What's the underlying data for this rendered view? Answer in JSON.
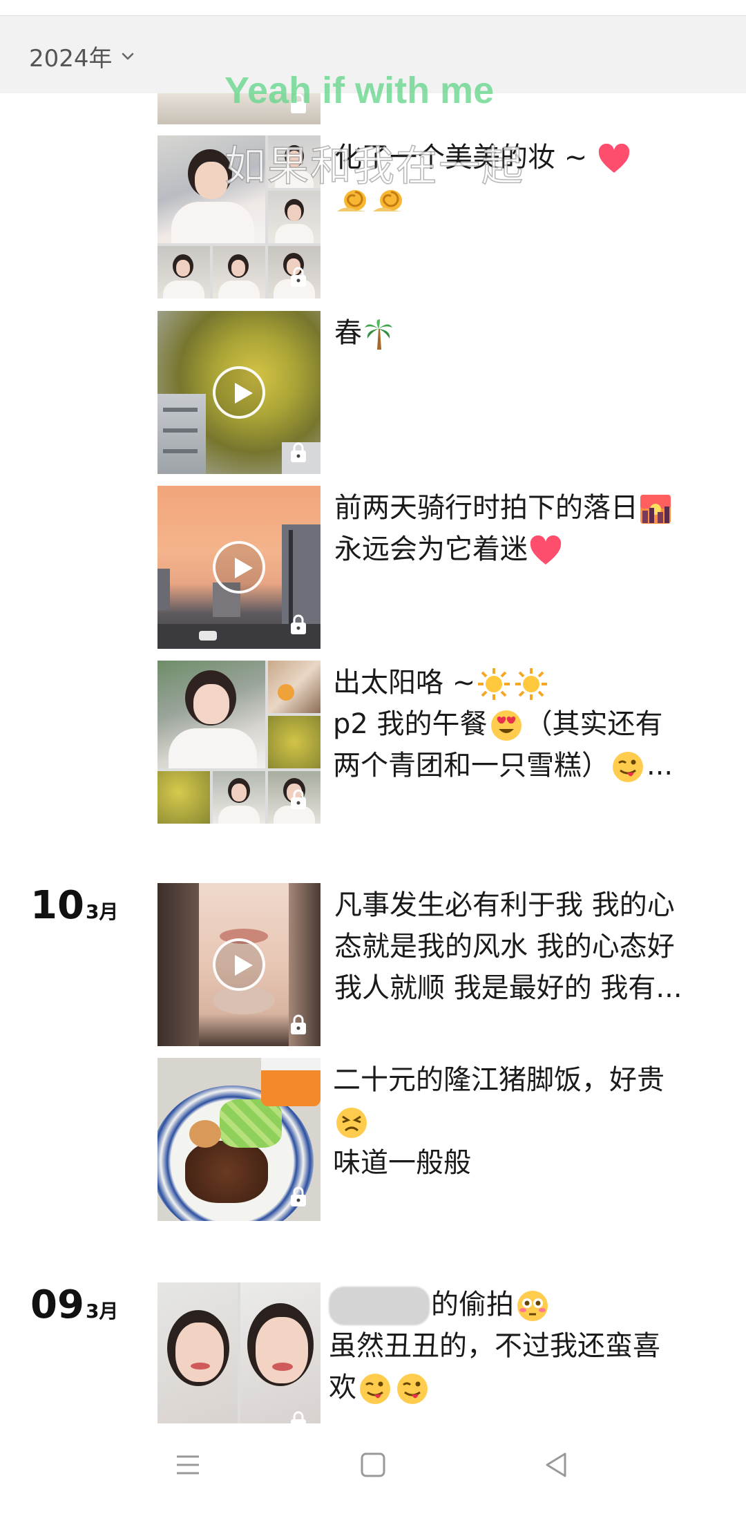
{
  "header": {
    "year_label": "2024年"
  },
  "overlay": {
    "english_lyric": "Yeah if with me",
    "chinese_lyric": "如果和我在一起"
  },
  "posts": [
    {
      "text": "化了一个美美的妆 ~",
      "emoji": [
        "heart",
        "snail",
        "snail"
      ]
    },
    {
      "text": "春",
      "emoji": [
        "palm-tree"
      ]
    },
    {
      "line1": "前两天骑行时拍下的落日",
      "line2": "永远会为它着迷",
      "emoji": [
        "sunset",
        "heart"
      ]
    },
    {
      "line1": "出太阳咯 ~",
      "line2": "p2 我的午餐",
      "line3a": "（其实还有",
      "line3b": "两个青团和一只雪糕）",
      "ellipsis": "...",
      "emoji": [
        "sun",
        "sun",
        "heart-eyes",
        "wink-tongue"
      ]
    },
    {
      "line1": "凡事发生必有利于我 我的心",
      "line2": "态就是我的风水 我的心态好",
      "line3": "我人就顺 我是最好的 我有...",
      "emoji": []
    },
    {
      "line1": "二十元的隆江猪脚饭，好贵",
      "line2": "味道一般般",
      "emoji": [
        "persevere"
      ]
    },
    {
      "line1_suffix": "的偷拍",
      "line2": "虽然丑丑的，不过我还蛮喜",
      "line3": "欢",
      "emoji": [
        "flushed",
        "wink-tongue",
        "wink-tongue"
      ]
    }
  ],
  "dates": [
    {
      "day": "10",
      "month": "3月"
    },
    {
      "day": "09",
      "month": "3月"
    }
  ],
  "nav": {
    "icons": [
      "menu-icon",
      "home-square-icon",
      "back-triangle-icon"
    ]
  },
  "colors": {
    "overlay_green": "#66d68c",
    "heart": "#ff4d6d",
    "header_bg": "#f2f2f2"
  }
}
